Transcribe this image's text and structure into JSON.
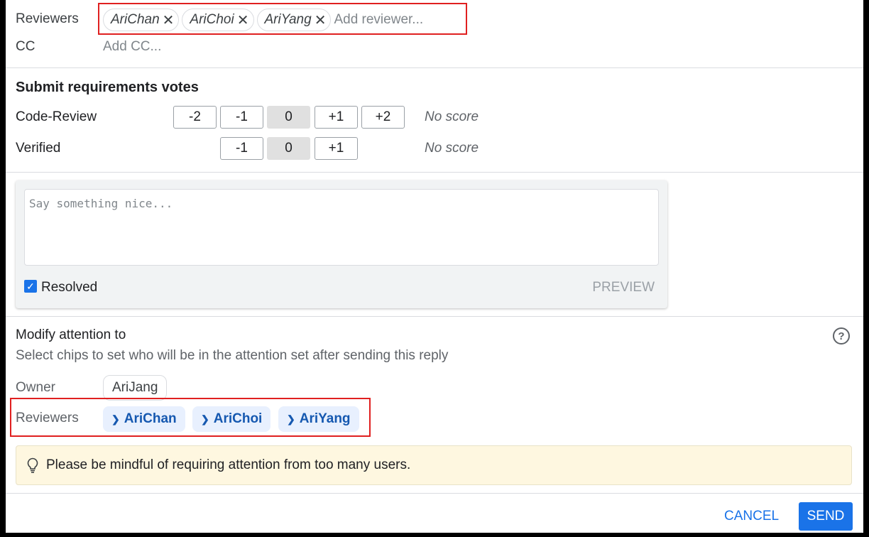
{
  "reviewers_field": {
    "label": "Reviewers",
    "chips": [
      "AriChan",
      "AriChoi",
      "AriYang"
    ],
    "remove_glyph": "✕",
    "placeholder": "Add reviewer..."
  },
  "cc_field": {
    "label": "CC",
    "placeholder": "Add CC..."
  },
  "votes": {
    "title": "Submit requirements votes",
    "code_review": {
      "label": "Code-Review",
      "options": [
        "-2",
        "-1",
        "0",
        "+1",
        "+2"
      ],
      "selected": "0",
      "status": "No score"
    },
    "verified": {
      "label": "Verified",
      "options": [
        "-1",
        "0",
        "+1"
      ],
      "selected": "0",
      "status": "No score"
    }
  },
  "comment": {
    "placeholder": "Say something nice...",
    "resolved_label": "Resolved",
    "resolved_checked": true,
    "preview_label": "PREVIEW"
  },
  "attention": {
    "title": "Modify attention to",
    "subtitle": "Select chips to set who will be in the attention set after sending this reply",
    "help_glyph": "?",
    "owner_label": "Owner",
    "owner": "AriJang",
    "reviewers_label": "Reviewers",
    "reviewers": [
      "AriChan",
      "AriChoi",
      "AriYang"
    ]
  },
  "notice": {
    "text": "Please be mindful of requiring attention from too many users.",
    "icon": "lightbulb-icon"
  },
  "actions": {
    "cancel": "CANCEL",
    "send": "SEND"
  },
  "colors": {
    "accent": "#1a73e8",
    "highlight_box": "#e02020",
    "notice_bg": "#fef7e0",
    "chip_bg": "#e8f0fe"
  }
}
